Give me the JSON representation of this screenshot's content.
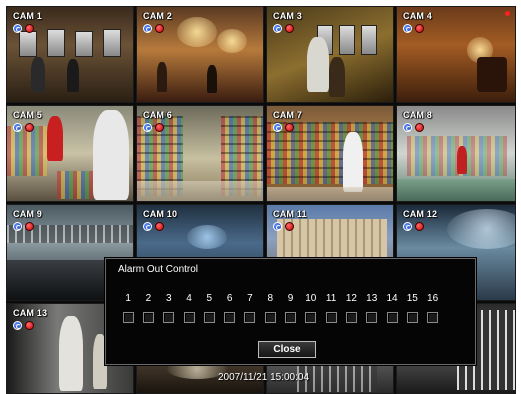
{
  "cameras": [
    {
      "label": "CAM 1"
    },
    {
      "label": "CAM 2"
    },
    {
      "label": "CAM 3"
    },
    {
      "label": "CAM 4"
    },
    {
      "label": "CAM 5"
    },
    {
      "label": "CAM 6"
    },
    {
      "label": "CAM 7"
    },
    {
      "label": "CAM 8"
    },
    {
      "label": "CAM 9"
    },
    {
      "label": "CAM 10"
    },
    {
      "label": "CAM 11"
    },
    {
      "label": "CAM 12"
    },
    {
      "label": "CAM 13"
    }
  ],
  "dialog": {
    "title": "Alarm Out Control",
    "channels": [
      "1",
      "2",
      "3",
      "4",
      "5",
      "6",
      "7",
      "8",
      "9",
      "10",
      "11",
      "12",
      "13",
      "14",
      "15",
      "16"
    ],
    "close_label": "Close"
  },
  "status": {
    "timestamp": "2007/11/21 15:00:04"
  },
  "colors": {
    "recording_icon": "#2a55d4",
    "alarm_icon": "#e00000",
    "dialog_background": "#050505"
  },
  "icons": {
    "recording": "record-status-icon",
    "alarm": "alarm-status-icon"
  }
}
